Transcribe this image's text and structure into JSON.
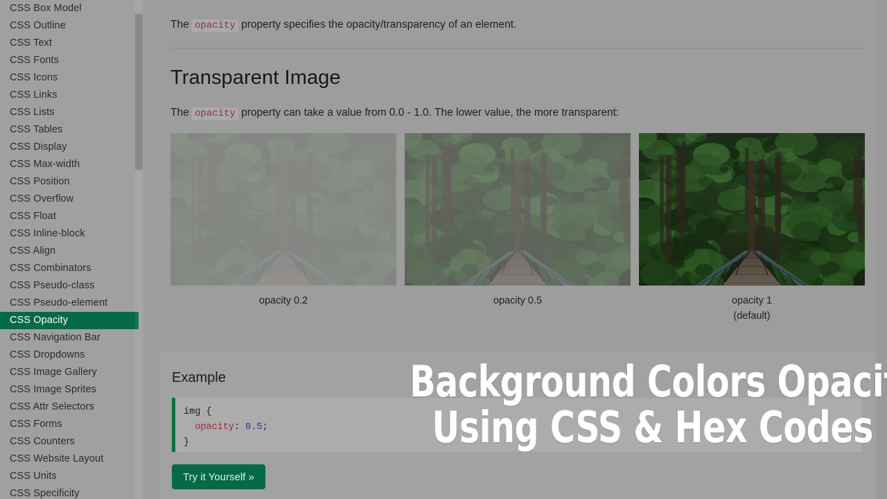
{
  "sidebar": {
    "scrollbar": {
      "name": "sidebar-scrollbar"
    },
    "items": [
      {
        "label": "CSS Box Model",
        "active": false
      },
      {
        "label": "CSS Outline",
        "active": false
      },
      {
        "label": "CSS Text",
        "active": false
      },
      {
        "label": "CSS Fonts",
        "active": false
      },
      {
        "label": "CSS Icons",
        "active": false
      },
      {
        "label": "CSS Links",
        "active": false
      },
      {
        "label": "CSS Lists",
        "active": false
      },
      {
        "label": "CSS Tables",
        "active": false
      },
      {
        "label": "CSS Display",
        "active": false
      },
      {
        "label": "CSS Max-width",
        "active": false
      },
      {
        "label": "CSS Position",
        "active": false
      },
      {
        "label": "CSS Overflow",
        "active": false
      },
      {
        "label": "CSS Float",
        "active": false
      },
      {
        "label": "CSS Inline-block",
        "active": false
      },
      {
        "label": "CSS Align",
        "active": false
      },
      {
        "label": "CSS Combinators",
        "active": false
      },
      {
        "label": "CSS Pseudo-class",
        "active": false
      },
      {
        "label": "CSS Pseudo-element",
        "active": false
      },
      {
        "label": "CSS Opacity",
        "active": true
      },
      {
        "label": "CSS Navigation Bar",
        "active": false
      },
      {
        "label": "CSS Dropdowns",
        "active": false
      },
      {
        "label": "CSS Image Gallery",
        "active": false
      },
      {
        "label": "CSS Image Sprites",
        "active": false
      },
      {
        "label": "CSS Attr Selectors",
        "active": false
      },
      {
        "label": "CSS Forms",
        "active": false
      },
      {
        "label": "CSS Counters",
        "active": false
      },
      {
        "label": "CSS Website Layout",
        "active": false
      },
      {
        "label": "CSS Units",
        "active": false
      },
      {
        "label": "CSS Specificity",
        "active": false
      }
    ]
  },
  "main": {
    "intro": {
      "before": "The ",
      "code": "opacity",
      "after": " property specifies the opacity/transparency of an element."
    },
    "section_title": "Transparent Image",
    "lead": {
      "before": "The ",
      "code": "opacity",
      "after": " property can take a value from 0.0 - 1.0. The lower value, the more transparent:"
    },
    "images": [
      {
        "caption": "opacity 0.2",
        "caption2": "",
        "opacity": 0.2
      },
      {
        "caption": "opacity 0.5",
        "caption2": "",
        "opacity": 0.5
      },
      {
        "caption": "opacity 1",
        "caption2": "(default)",
        "opacity": 1
      }
    ],
    "example": {
      "title": "Example",
      "code_lines": [
        {
          "plain": "img {"
        },
        {
          "indent": "  ",
          "prop": "opacity",
          "colon": ": ",
          "val": "0.5",
          "semi": ";"
        },
        {
          "plain": "}"
        }
      ],
      "try_label": "Try it Yourself »"
    }
  },
  "overlay": {
    "line1": "Background Colors Opacity",
    "line2": "Using CSS & Hex Codes"
  },
  "colors": {
    "accent_green": "#046a45",
    "page_bg": "#9a9a9a",
    "content_bg": "#9d9d9d",
    "code_red": "#9a2a3c",
    "code_blue": "#2b2fa8",
    "overlay_text": "#ffffff"
  }
}
